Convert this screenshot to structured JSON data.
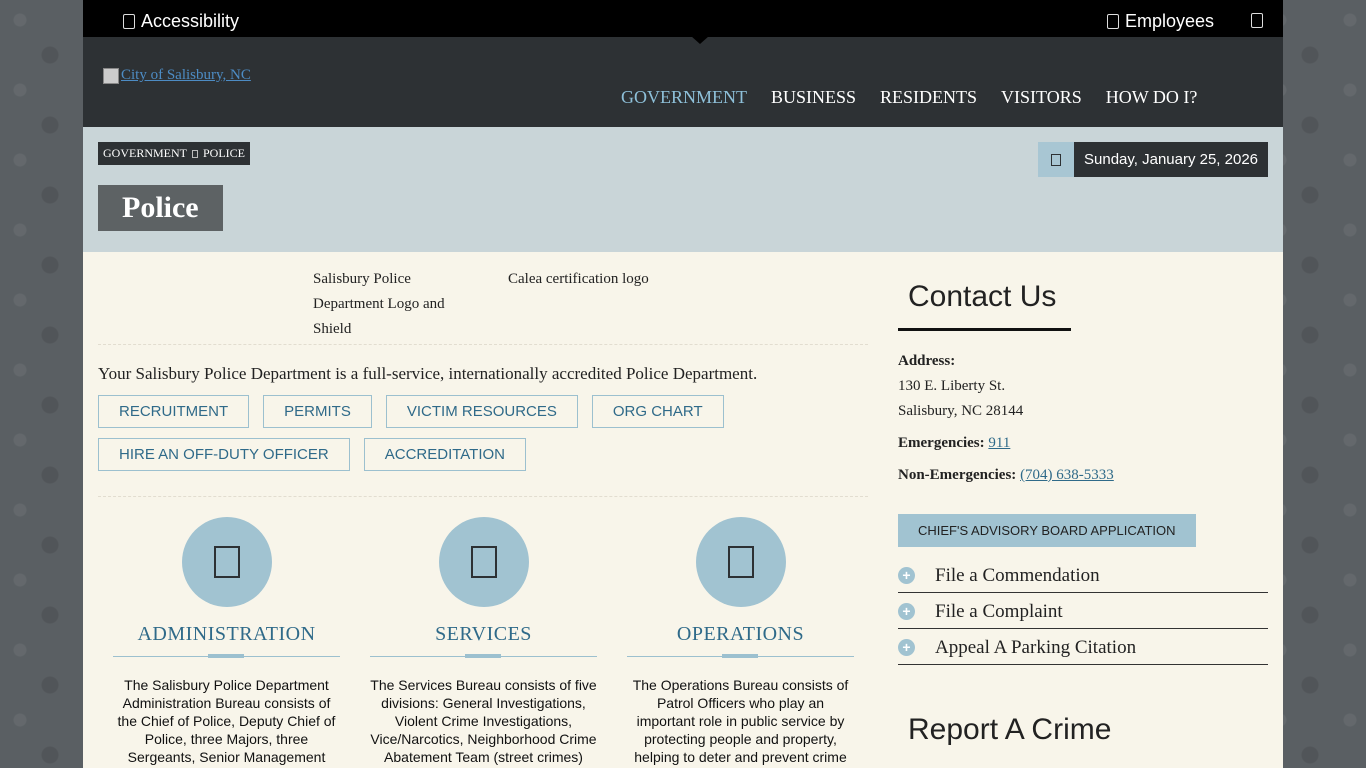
{
  "topbar": {
    "accessibility": "Accessibility",
    "employees": "Employees"
  },
  "header": {
    "logo_alt": "City of Salisbury, NC",
    "nav": [
      "GOVERNMENT",
      "BUSINESS",
      "RESIDENTS",
      "VISITORS",
      "HOW DO I?"
    ]
  },
  "titleband": {
    "breadcrumb": [
      "GOVERNMENT",
      "POLICE"
    ],
    "date": "Sunday, January 25, 2026",
    "page_title": "Police"
  },
  "main": {
    "image_alts": [
      "Salisbury Police Department Logo and Shield",
      "Calea certification logo"
    ],
    "intro": "Your Salisbury Police Department is a full-service, internationally accredited Police Department.",
    "quick_links": [
      "RECRUITMENT",
      "PERMITS",
      "VICTIM RESOURCES",
      "ORG CHART",
      "HIRE AN OFF-DUTY OFFICER",
      "ACCREDITATION"
    ],
    "columns": [
      {
        "title": "ADMINISTRATION",
        "text": "The Salisbury Police Department Administration Bureau consists of the Chief of Police, Deputy Chief of Police, three Majors, three Sergeants, Senior Management"
      },
      {
        "title": "SERVICES",
        "text": "The Services Bureau consists of five divisions: General Investigations, Violent Crime Investigations, Vice/Narcotics, Neighborhood Crime Abatement Team (street crimes)"
      },
      {
        "title": "OPERATIONS",
        "text": "The Operations Bureau consists of Patrol Officers who play an important role in public service by protecting people and property, helping to deter and prevent crime"
      }
    ]
  },
  "sidebar": {
    "contact_title": "Contact Us",
    "address_label": "Address:",
    "address_line1": "130 E. Liberty St.",
    "address_line2": "Salisbury, NC 28144",
    "emergencies_label": "Emergencies:",
    "emergencies_number": "911",
    "non_emergencies_label": "Non-Emergencies:",
    "non_emergencies_number": "(704) 638-5333",
    "cab_button": "CHIEF'S ADVISORY BOARD APPLICATION",
    "accordion": [
      "File a Commendation",
      "File a Complaint",
      "Appeal A Parking Citation"
    ],
    "report_title": "Report A Crime"
  }
}
